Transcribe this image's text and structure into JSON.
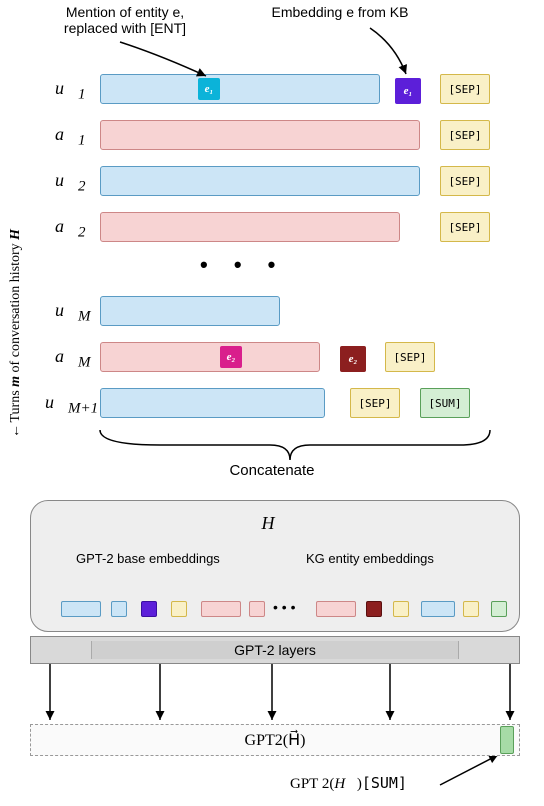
{
  "annotations": {
    "mention": "Mention of entity e,\nreplaced with [ENT]",
    "embedding": "Embedding e from KB"
  },
  "side_label_prefix": "Turns ",
  "side_label_mid": "m",
  "side_label_suffix": " of conversation history ",
  "side_label_H": "H",
  "rows": {
    "u1": "u⃗₁",
    "a1": "a⃗₁",
    "u2": "u⃗₂",
    "a2": "a⃗₂",
    "uM": "u⃗ₘ",
    "aM": "a⃗ₘ",
    "uMp1": "u⃗ₘ₊₁"
  },
  "entity_tokens": {
    "e1": "e₁",
    "e2": "e₂"
  },
  "tokens": {
    "sep": "[SEP]",
    "sum": "[SUM]"
  },
  "brace_label": "Concatenate",
  "encoder": {
    "H": "H⃗",
    "left_label": "GPT-2 base embeddings",
    "right_label": "KG entity embeddings",
    "layers": "GPT-2 layers"
  },
  "output": {
    "box": "GPT2(H⃗)",
    "pointer": "GPT 2(H⃗)[SUM]"
  },
  "chart_data": {
    "type": "diagram",
    "description": "Conversation history turns (user u and assistant a bars) with entity mentions replaced by [ENT] and KB entity embeddings appended, all concatenated with [SEP]/[SUM] tokens into sequence H⃗ fed through GPT-2 layers producing GPT2(H⃗); the [SUM] position output is GPT2(H⃗)[SUM].",
    "turns": [
      "u1",
      "a1",
      "u2",
      "a2",
      "...",
      "uM",
      "aM",
      "uM+1"
    ],
    "special_tokens": [
      "[SEP]",
      "[SUM]",
      "[ENT]"
    ],
    "entities": [
      "e1",
      "e2"
    ]
  }
}
